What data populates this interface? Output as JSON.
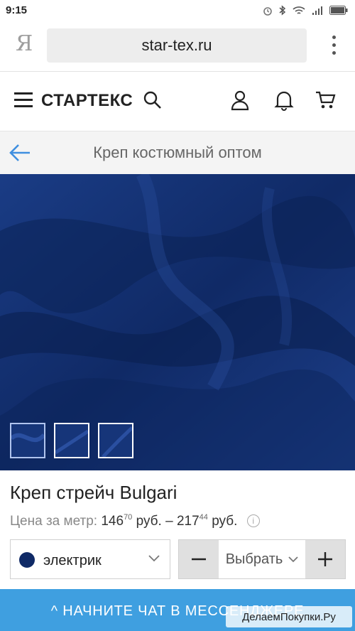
{
  "status_bar": {
    "time": "9:15",
    "icons": [
      "alarm-icon",
      "bluetooth-icon",
      "wifi-icon",
      "signal-icon",
      "battery-icon"
    ]
  },
  "browser": {
    "logo": "Я",
    "url": "star-tex.ru"
  },
  "header": {
    "brand": "СТАРТЕКС"
  },
  "title_bar": {
    "title": "Креп костюмный оптом"
  },
  "product": {
    "name": "Креп стрейч Bulgari",
    "price_label": "Цена за метр:",
    "price_min_int": "146",
    "price_min_frac": "70",
    "currency": "руб.",
    "dash": "–",
    "price_max_int": "217",
    "price_max_frac": "44",
    "thumbnails": 3
  },
  "color_select": {
    "value": "электрик",
    "swatch_color": "#0f2a66"
  },
  "quantity": {
    "placeholder": "Выбрать"
  },
  "chat_bar": {
    "label": "НАЧНИТЕ ЧАТ В МЕССЕНДЖЕРЕ"
  },
  "watermark": {
    "text": "ДелаемПокупки.Ру"
  },
  "colors": {
    "accent": "#3f9fe0",
    "fabric": "#13306e"
  }
}
